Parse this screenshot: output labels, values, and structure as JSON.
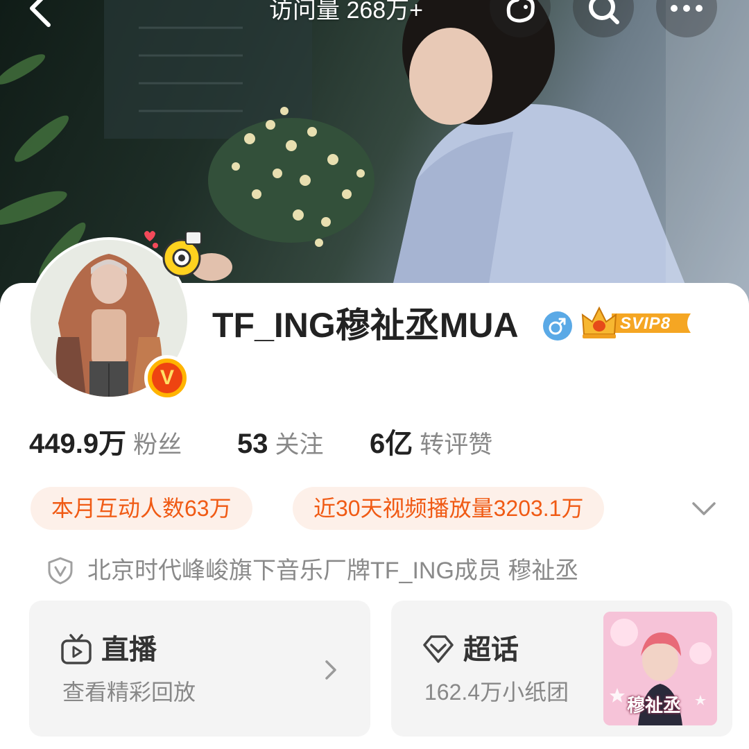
{
  "header": {
    "visits_label": "访问量 268万+",
    "icons": [
      "back-icon",
      "sticker-icon",
      "search-icon",
      "more-icon"
    ]
  },
  "profile": {
    "name": "TF_ING穆祉丞MUA",
    "gender": "male",
    "vip_label": "SVIP8",
    "verified": true,
    "verify_mark": "V"
  },
  "stats": [
    {
      "value": "449.9万",
      "label": "粉丝"
    },
    {
      "value": "53",
      "label": "关注"
    },
    {
      "value": "6亿",
      "label": "转评赞"
    }
  ],
  "highlights": [
    "本月互动人数63万",
    "近30天视频播放量3203.1万"
  ],
  "description": "北京时代峰峻旗下音乐厂牌TF_ING成员 穆祉丞",
  "entries": {
    "live": {
      "title": "直播",
      "subtitle": "查看精彩回放"
    },
    "super_topic": {
      "title": "超话",
      "subtitle": "162.4万小纸团",
      "thumb_text": "穆祉丞"
    }
  },
  "colors": {
    "accent": "#f05a14",
    "pill_bg": "#fdf0e9",
    "gender_blue": "#5aa9e6",
    "vip_gold": "#f5a623"
  }
}
